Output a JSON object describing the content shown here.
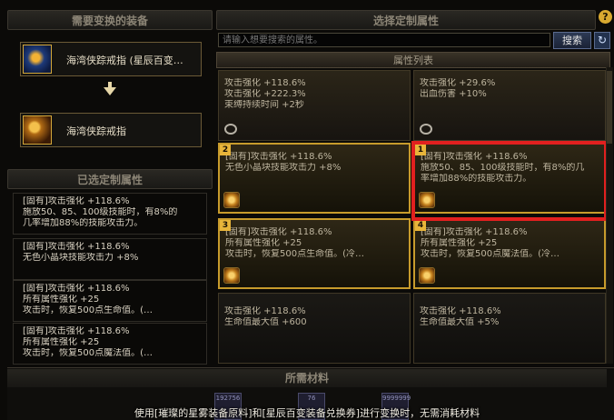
{
  "left": {
    "title": "需要变换的装备",
    "source_item": {
      "name": "海湾侠踪戒指 (星辰百变…"
    },
    "target_item": {
      "name": "海湾侠踪戒指"
    },
    "selected_title": "已选定制属性",
    "selected": [
      {
        "lines": [
          "[固有]攻击强化 +118.6%",
          "施放50、85、100级技能时，有8%的",
          "几率增加88%的技能攻击力。"
        ]
      },
      {
        "lines": [
          "[固有]攻击强化 +118.6%",
          "无色小晶块技能攻击力 +8%"
        ]
      },
      {
        "lines": [
          "[固有]攻击强化 +118.6%",
          "所有属性强化 +25",
          "攻击时，恢复500点生命值。(…"
        ]
      },
      {
        "lines": [
          "[固有]攻击强化 +118.6%",
          "所有属性强化 +25",
          "攻击时，恢复500点魔法值。(…"
        ]
      }
    ]
  },
  "right": {
    "title": "选择定制属性",
    "search": {
      "placeholder": "请输入想要搜索的属性。",
      "button": "搜索"
    },
    "list_title": "属性列表",
    "cells": [
      {
        "num": "",
        "lines": [
          "攻击强化 +118.6%",
          "攻击强化 +222.3%",
          "束缚持续时间 +2秒"
        ]
      },
      {
        "num": "",
        "lines": [
          "攻击强化 +29.6%",
          "出血伤害 +10%"
        ]
      },
      {
        "num": "2",
        "lines": [
          "[固有]攻击强化 +118.6%",
          "无色小晶块技能攻击力 +8%"
        ]
      },
      {
        "num": "1",
        "lines": [
          "[固有]攻击强化 +118.6%",
          "施放50、85、100级技能时，有8%的几",
          "率增加88%的技能攻击力。"
        ]
      },
      {
        "num": "3",
        "lines": [
          "[固有]攻击强化 +118.6%",
          "所有属性强化 +25",
          "攻击时，恢复500点生命值。(冷…"
        ]
      },
      {
        "num": "4",
        "lines": [
          "[固有]攻击强化 +118.6%",
          "所有属性强化 +25",
          "攻击时，恢复500点魔法值。(冷…"
        ]
      },
      {
        "num": "",
        "lines": [
          "攻击强化 +118.6%",
          "生命值最大值 +600"
        ]
      },
      {
        "num": "",
        "lines": [
          "攻击强化 +118.6%",
          "生命值最大值 +5%"
        ]
      }
    ]
  },
  "bottom": {
    "title": "所需材料",
    "materials": [
      "192756",
      "76",
      "9999999"
    ],
    "note": "使用[璀璨的星雾装备原料]和[星辰百变装备兑换券]进行变换时，无需消耗材料"
  },
  "colors": {
    "highlight": "#e2201f",
    "gold_border": "#c79b2c"
  },
  "icons": {
    "help": "?",
    "refresh": "↻"
  }
}
